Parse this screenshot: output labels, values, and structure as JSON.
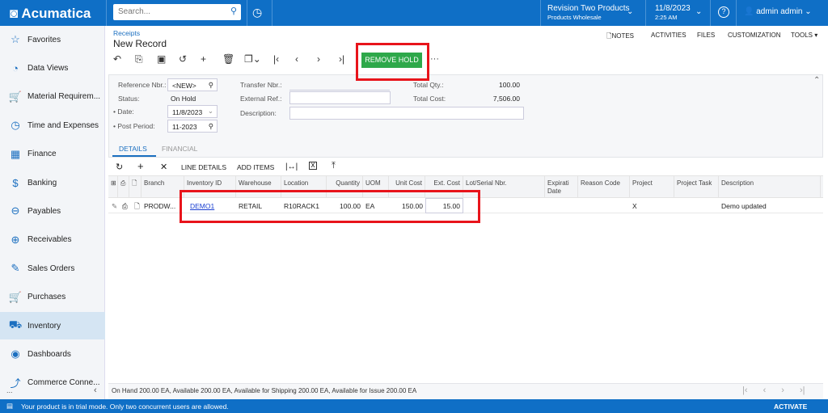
{
  "app": {
    "logo": "Acumatica",
    "search_placeholder": "Search...",
    "company": "Revision Two Products",
    "branch": "Products Wholesale",
    "date": "11/8/2023",
    "time": "2:25 AM",
    "user": "admin admin"
  },
  "sidebar": {
    "items": [
      {
        "label": "Favorites",
        "icon": "star-icon"
      },
      {
        "label": "Data Views",
        "icon": "pie-chart-icon"
      },
      {
        "label": "Material Requirem...",
        "icon": "cart-icon"
      },
      {
        "label": "Time and Expenses",
        "icon": "clock-icon"
      },
      {
        "label": "Finance",
        "icon": "calculator-icon"
      },
      {
        "label": "Banking",
        "icon": "dollar-icon"
      },
      {
        "label": "Payables",
        "icon": "minus-circle-icon"
      },
      {
        "label": "Receivables",
        "icon": "plus-circle-icon"
      },
      {
        "label": "Sales Orders",
        "icon": "edit-icon"
      },
      {
        "label": "Purchases",
        "icon": "cart-icon"
      },
      {
        "label": "Inventory",
        "icon": "truck-icon"
      },
      {
        "label": "Dashboards",
        "icon": "gauge-icon"
      },
      {
        "label": "Commerce Conne...",
        "icon": "connector-icon"
      }
    ],
    "active": "Inventory",
    "more": "..."
  },
  "page": {
    "breadcrumb": "Receipts",
    "title": "New Record",
    "links": [
      "NOTES",
      "ACTIVITIES",
      "FILES",
      "CUSTOMIZATION",
      "TOOLS ▾"
    ],
    "remove_hold": "REMOVE HOLD",
    "more": "···"
  },
  "form": {
    "ref_label": "Reference Nbr.:",
    "ref_value": "<NEW>",
    "status_label": "Status:",
    "status_value": "On Hold",
    "date_label": "Date:",
    "date_value": "11/8/2023",
    "period_label": "Post Period:",
    "period_value": "11-2023",
    "transfer_label": "Transfer Nbr.:",
    "extref_label": "External Ref.:",
    "desc_label": "Description:",
    "totqty_label": "Total Qty.:",
    "totqty_value": "100.00",
    "totcost_label": "Total Cost:",
    "totcost_value": "7,506.00"
  },
  "tabs": [
    "DETAILS",
    "FINANCIAL"
  ],
  "grid": {
    "toolbar": {
      "line_details": "LINE DETAILS",
      "add_items": "ADD ITEMS"
    },
    "columns": [
      "Branch",
      "Inventory ID",
      "Warehouse",
      "Location",
      "Quantity",
      "UOM",
      "Unit Cost",
      "Ext. Cost",
      "Lot/Serial Nbr.",
      "Expirati Date",
      "Reason Code",
      "Project",
      "Project Task",
      "Description"
    ],
    "rows": [
      {
        "branch": "PRODW...",
        "inventory_id": "DEMO1",
        "warehouse": "RETAIL",
        "location": "R10RACK1",
        "quantity": "100.00",
        "uom": "EA",
        "unit_cost": "150.00",
        "ext_cost": "15.00",
        "lot": "",
        "exp": "",
        "reason": "",
        "project": "X",
        "task": "",
        "description": "Demo updated"
      }
    ]
  },
  "status_line": "On Hand 200.00 EA, Available 200.00 EA, Available for Shipping 200.00 EA, Available for Issue 200.00 EA",
  "footer": {
    "message": "Your product is in trial mode. Only two concurrent users are allowed.",
    "activate": "ACTIVATE"
  },
  "colors": {
    "brand": "#0f6fc6",
    "remove_hold": "#2ea84a",
    "highlight": "#e8141b"
  }
}
